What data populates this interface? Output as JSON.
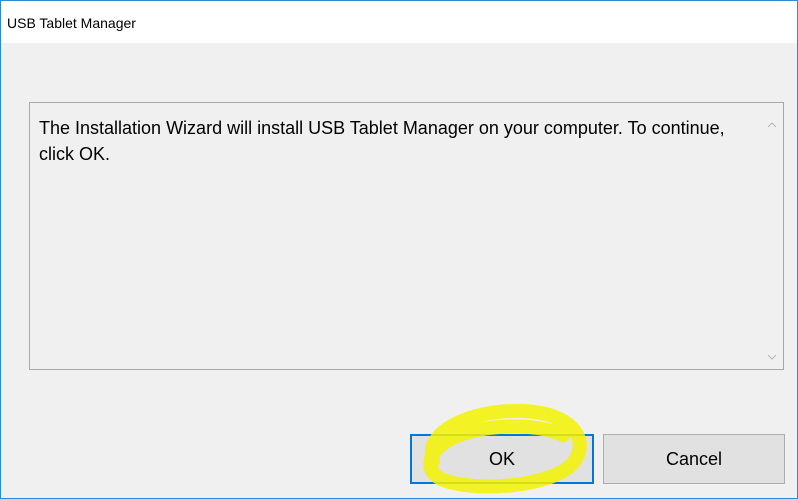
{
  "window": {
    "title": "USB Tablet Manager"
  },
  "message": {
    "text": "The Installation Wizard will install USB Tablet Manager on your computer.  To continue, click OK."
  },
  "scrollbar": {
    "up_icon": "chevron-up-icon",
    "down_icon": "chevron-down-icon"
  },
  "buttons": {
    "ok_label": "OK",
    "cancel_label": "Cancel"
  },
  "colors": {
    "window_border": "#2b8ad6",
    "dialog_background": "#f0f0f0",
    "button_background": "#e1e1e1",
    "focus_border": "#0078d7",
    "highlight_annotation": "#f2f200"
  }
}
